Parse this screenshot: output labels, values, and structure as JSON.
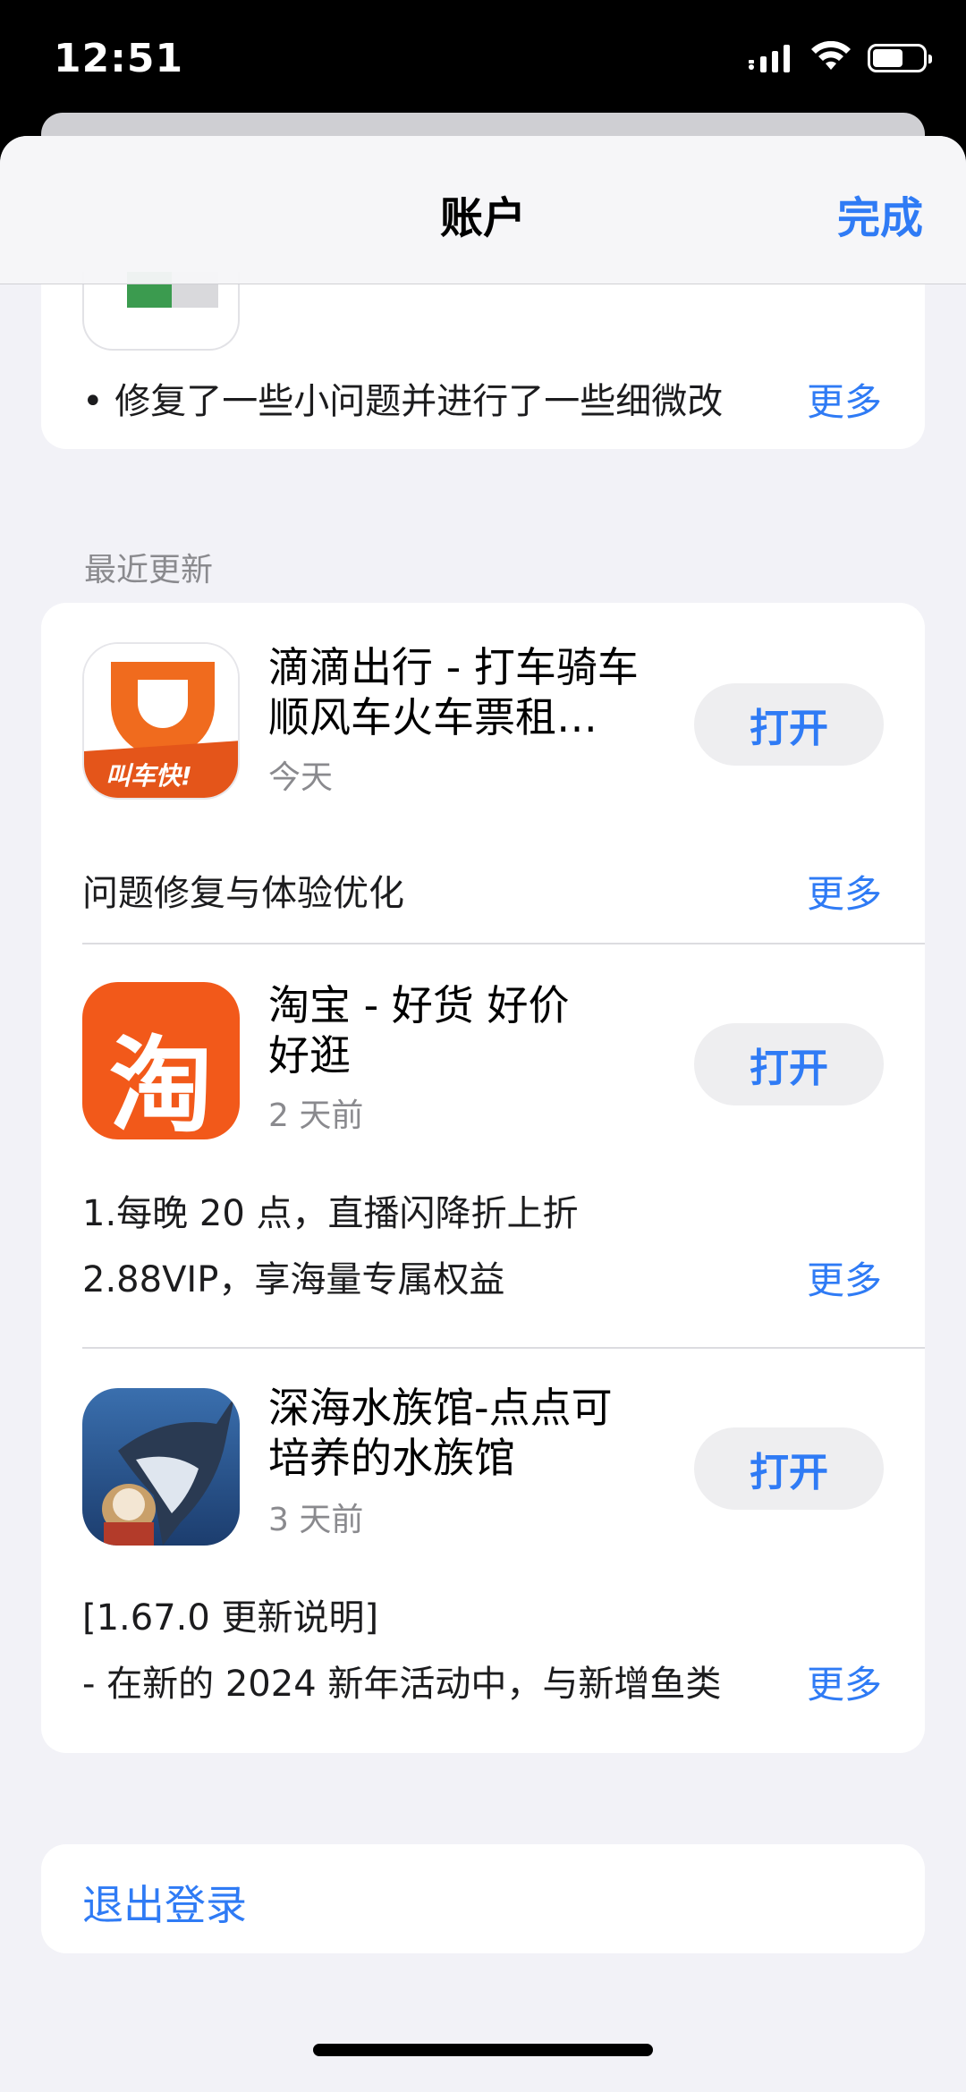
{
  "status": {
    "time": "12:51",
    "battery_level": 0.62
  },
  "nav": {
    "title": "账户",
    "done_label": "完成"
  },
  "top_card": {
    "note": "• 修复了一些小问题并进行了一些细微改",
    "more": "更多"
  },
  "section": {
    "header": "最近更新"
  },
  "apps": [
    {
      "name": "滴滴出行 - 打车骑车顺风车火车票租…",
      "name_line1": "滴滴出行 - 打车骑车",
      "name_line2": "顺风车火车票租…",
      "date": "今天",
      "open": "打开",
      "icon_label": "叫车快!",
      "notes": [
        "问题修复与体验优化"
      ],
      "more": "更多"
    },
    {
      "name_line1": "淘宝 - 好货 好价",
      "name_line2": "好逛",
      "date": "2 天前",
      "open": "打开",
      "icon_label": "淘",
      "notes": [
        "1.每晚 20 点，直播闪降折上折",
        "2.88VIP，享海量专属权益"
      ],
      "more": "更多"
    },
    {
      "name_line1": "深海水族馆-点点可",
      "name_line2": "培养的水族馆",
      "date": "3 天前",
      "open": "打开",
      "notes": [
        "[1.67.0 更新说明]",
        " - 在新的 2024 新年活动中，与新增鱼类"
      ],
      "more": "更多"
    }
  ],
  "logout": {
    "label": "退出登录"
  },
  "colors": {
    "accent": "#2f7bf5",
    "background": "#f2f2f7",
    "didi_orange": "#f06b1e",
    "taobao_orange": "#f2591a"
  },
  "icons": {
    "signal": "cellular-signal-icon",
    "wifi": "wifi-icon",
    "battery": "battery-icon"
  }
}
